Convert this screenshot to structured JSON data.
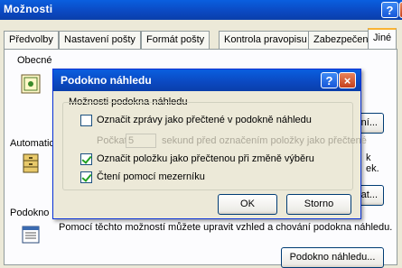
{
  "window": {
    "title": "Možnosti",
    "help": "?",
    "close": "×"
  },
  "tabs": [
    "Předvolby",
    "Nastavení pošty",
    "Formát pošty",
    "Kontrola pravopisu",
    "Zabezpečení",
    "Jiné"
  ],
  "panel": {
    "general_label": "Obecné",
    "general_btn_tail": "vení...",
    "auto_label": "Automatic",
    "auto_text1": "k",
    "auto_text2": "ek.",
    "auto_btn_tail": "ivovat...",
    "pane_label": "Podokno n",
    "pane_text": "Pomocí těchto možností můžete upravit vzhled a chování podokna náhledu.",
    "pane_button": "Podokno náhledu..."
  },
  "dialog": {
    "title": "Podokno náhledu",
    "group_label": "Možnosti podokna náhledu",
    "option1": {
      "label": "Označit zprávy jako přečtené v podokně náhledu",
      "checked": false
    },
    "wait_label": "Počkat",
    "wait_value": "5",
    "wait_suffix": "sekund před označením položky jako přečtené",
    "option2": {
      "label": "Označit položku jako přečtenou při změně výběru",
      "checked": true
    },
    "option3": {
      "label": "Čtení pomocí mezerníku",
      "checked": true
    },
    "ok": "OK",
    "cancel": "Storno"
  }
}
